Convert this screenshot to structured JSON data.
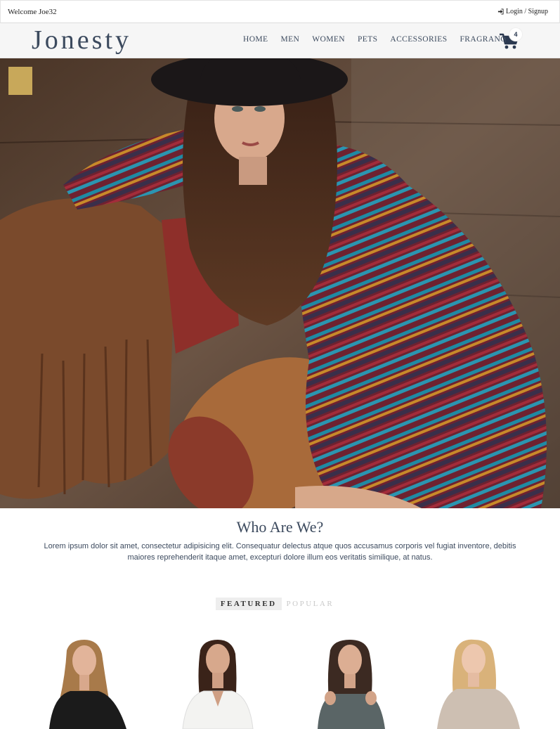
{
  "topbar": {
    "welcome": "Welcome Joe32",
    "login": "Login / Signup",
    "login_icon": "sign-in-icon"
  },
  "header": {
    "logo": "Jonesty",
    "nav": [
      "HOME",
      "MEN",
      "WOMEN",
      "PETS",
      "ACCESSORIES",
      "FRAGRANCE"
    ],
    "cart_icon": "shopping-cart-icon",
    "cart_count": "4"
  },
  "hero": {
    "image": "model-in-striped-sweater-dress-and-hat"
  },
  "about": {
    "title": "Who Are We?",
    "text": "Lorem ipsum dolor sit amet, consectetur adipisicing elit. Consequatur delectus atque quos accusamus corporis vel fugiat inventore, debitis maiores reprehenderit itaque amet, excepturi dolore illum eos veritatis similique, at natus."
  },
  "tabs": {
    "featured": "FEATURED",
    "popular": "POPULAR"
  },
  "products": [
    {
      "image": "woman-black-lace-top"
    },
    {
      "image": "woman-white-blouse"
    },
    {
      "image": "woman-gray-cold-shoulder-top"
    },
    {
      "image": "woman-beige-off-shoulder-sweater"
    }
  ],
  "colors": {
    "brand": "#3c4a5e",
    "header_bg": "#f6f6f6",
    "tab_active_bg": "#eeeeee"
  }
}
